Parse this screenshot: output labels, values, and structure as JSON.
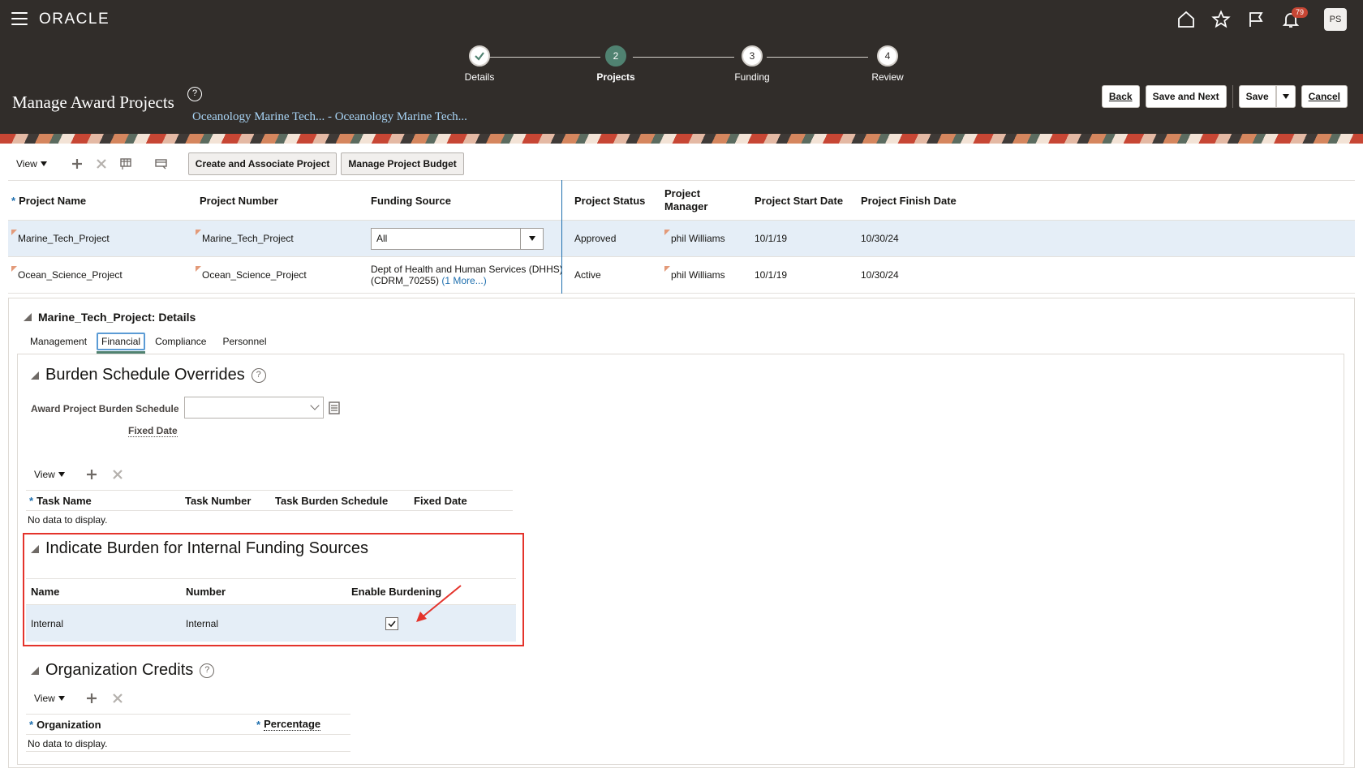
{
  "header": {
    "logo": "ORACLE",
    "notifications_count": "79",
    "avatar_initials": "PS",
    "page_title": "Manage Award Projects",
    "help_glyph": "?",
    "subtitle": "Oceanology Marine Tech... - Oceanology Marine Tech...",
    "buttons": {
      "back": "Back",
      "save_and_next": "Save and Next",
      "save": "Save",
      "cancel": "Cancel"
    }
  },
  "train": {
    "stops": [
      {
        "number": "✓",
        "label": "Details",
        "state": "complete"
      },
      {
        "number": "2",
        "label": "Projects",
        "state": "current"
      },
      {
        "number": "3",
        "label": "Funding",
        "state": "upcoming"
      },
      {
        "number": "4",
        "label": "Review",
        "state": "upcoming"
      }
    ]
  },
  "toolbar": {
    "view_label": "View",
    "create_button": "Create and Associate Project",
    "budget_button": "Manage Project Budget"
  },
  "projects_table": {
    "columns": [
      "Project Name",
      "Project Number",
      "Funding Source",
      "Project Status",
      "Project Manager",
      "Project Start Date",
      "Project Finish Date"
    ],
    "required_marker": "*",
    "rows": [
      {
        "name": "Marine_Tech_Project",
        "number": "Marine_Tech_Project",
        "funding": "All",
        "status": "Approved",
        "manager": "phil Williams",
        "start": "10/1/19",
        "finish": "10/30/24"
      },
      {
        "name": "Ocean_Science_Project",
        "number": "Ocean_Science_Project",
        "funding_line1": "Dept of Health and Human Services (DHHS)",
        "funding_line2": "(CDRM_70255)",
        "funding_more": "(1 More...)",
        "status": "Active",
        "manager": "phil Williams",
        "start": "10/1/19",
        "finish": "10/30/24"
      }
    ]
  },
  "details": {
    "title": "Marine_Tech_Project: Details",
    "tabs": [
      "Management",
      "Financial",
      "Compliance",
      "Personnel"
    ],
    "active_tab": "Financial",
    "burden": {
      "title": "Burden Schedule Overrides",
      "schedule_label": "Award Project Burden Schedule",
      "fixed_date_label": "Fixed Date",
      "view_label": "View",
      "columns": [
        "Task Name",
        "Task Number",
        "Task Burden Schedule",
        "Fixed Date"
      ],
      "empty_text": "No data to display."
    },
    "internal": {
      "title": "Indicate Burden for Internal Funding Sources",
      "columns": [
        "Name",
        "Number",
        "Enable Burdening"
      ],
      "row": {
        "name": "Internal",
        "number": "Internal",
        "enabled": true
      }
    },
    "org_credits": {
      "title": "Organization Credits",
      "view_label": "View",
      "columns": [
        "Organization",
        "Percentage"
      ],
      "empty_text": "No data to display."
    }
  },
  "colors": {
    "header_bg": "#312d2a",
    "accent_green": "#508271",
    "highlight_red": "#e4332b",
    "selected_row": "#e5eef7"
  }
}
